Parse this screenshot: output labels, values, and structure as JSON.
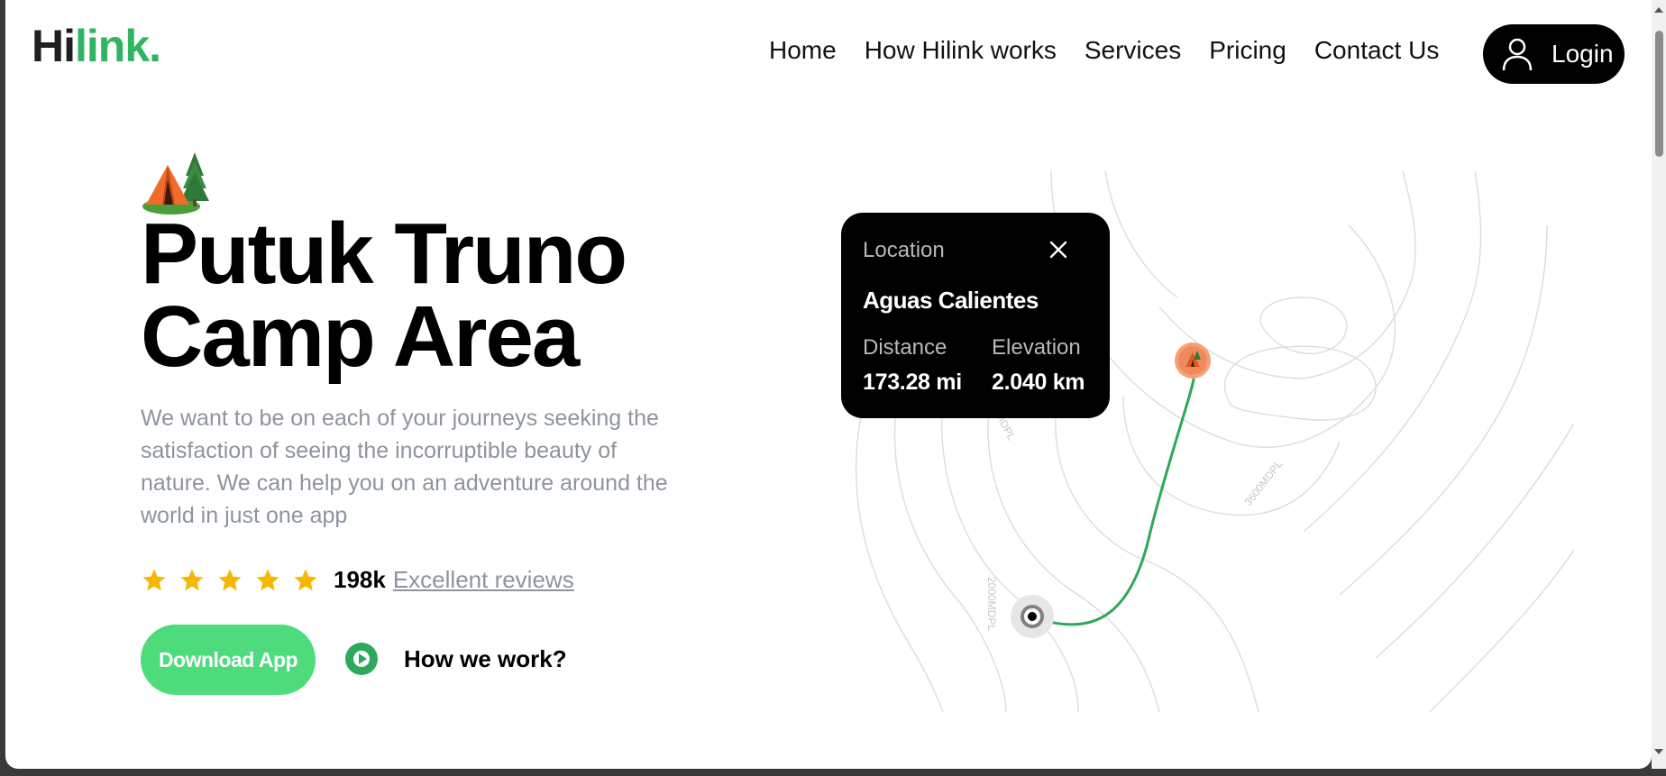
{
  "header": {
    "logo_hi": "Hi",
    "logo_link": "link.",
    "nav": [
      "Home",
      "How Hilink works",
      "Services",
      "Pricing",
      "Contact Us"
    ],
    "login_label": "Login"
  },
  "hero": {
    "title_line1": "Putuk Truno",
    "title_line2": "Camp Area",
    "description": "We want to be on each of your journeys seeking the satisfaction of seeing the incorruptible beauty of nature. We can help you on an adventure around the world in just one app",
    "rating": {
      "stars": 5,
      "count": "198k",
      "link_label": "Excellent reviews"
    },
    "download_label": "Download App",
    "how_label": "How we work?"
  },
  "map": {
    "card": {
      "label": "Location",
      "name": "Aguas Calientes",
      "distance_label": "Distance",
      "distance_value": "173.28 mi",
      "elevation_label": "Elevation",
      "elevation_value": "2.040 km"
    },
    "contour_labels": [
      "2000MDPL",
      "3600MDPL",
      "MDPL"
    ]
  },
  "colors": {
    "brand_green": "#2fb561",
    "button_green": "#4ddb7c",
    "route_green": "#2ea85a",
    "pin_orange": "#f08a5d",
    "star_yellow": "#f5b800",
    "muted_text": "#8d949e"
  },
  "icons": [
    "user-icon",
    "close-icon",
    "star-icon",
    "play-icon",
    "tent-icon",
    "location-pin-icon"
  ]
}
